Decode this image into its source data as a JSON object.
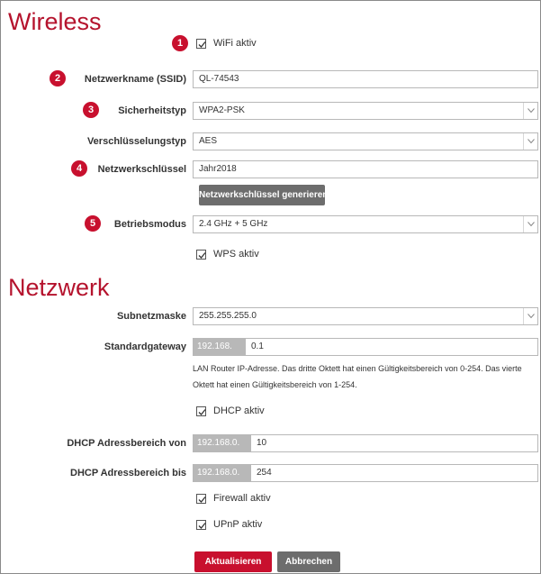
{
  "wireless": {
    "heading": "Wireless",
    "wifi_active": {
      "label": "WiFi aktiv",
      "marker": "1",
      "checked": true
    },
    "ssid": {
      "label": "Netzwerkname (SSID)",
      "marker": "2",
      "value": "QL-74543"
    },
    "security_type": {
      "label": "Sicherheitstyp",
      "marker": "3",
      "value": "WPA2-PSK"
    },
    "encryption_type": {
      "label": "Verschlüsselungstyp",
      "value": "AES"
    },
    "network_key": {
      "label": "Netzwerkschlüssel",
      "marker": "4",
      "value": "Jahr2018"
    },
    "generate_key_button": "Netzwerkschlüssel generieren",
    "operating_mode": {
      "label": "Betriebsmodus",
      "marker": "5",
      "value": "2.4 GHz + 5 GHz"
    },
    "wps_active": {
      "label": "WPS aktiv",
      "checked": true
    }
  },
  "network": {
    "heading": "Netzwerk",
    "subnet_mask": {
      "label": "Subnetzmaske",
      "value": "255.255.255.0"
    },
    "default_gateway": {
      "label": "Standardgateway",
      "prefix": "192.168.",
      "value": "0.1",
      "help_line1": "LAN Router IP-Adresse. Das dritte Oktett hat einen Gültigkeitsbereich von 0-254. Das vierte",
      "help_line2": "Oktett hat einen Gültigkeitsbereich von 1-254."
    },
    "dhcp_active": {
      "label": "DHCP aktiv",
      "checked": true
    },
    "dhcp_from": {
      "label": "DHCP Adressbereich von",
      "prefix": "192.168.0.",
      "value": "10"
    },
    "dhcp_to": {
      "label": "DHCP Adressbereich bis",
      "prefix": "192.168.0.",
      "value": "254"
    },
    "firewall_active": {
      "label": "Firewall aktiv",
      "checked": true
    },
    "upnp_active": {
      "label": "UPnP aktiv",
      "checked": true
    }
  },
  "actions": {
    "update": "Aktualisieren",
    "cancel": "Abbrechen"
  },
  "colors": {
    "accent": "#c8102e",
    "heading": "#b5132d",
    "gray_button": "#6d6d6d",
    "prefix_bg": "#b8b8b8"
  }
}
